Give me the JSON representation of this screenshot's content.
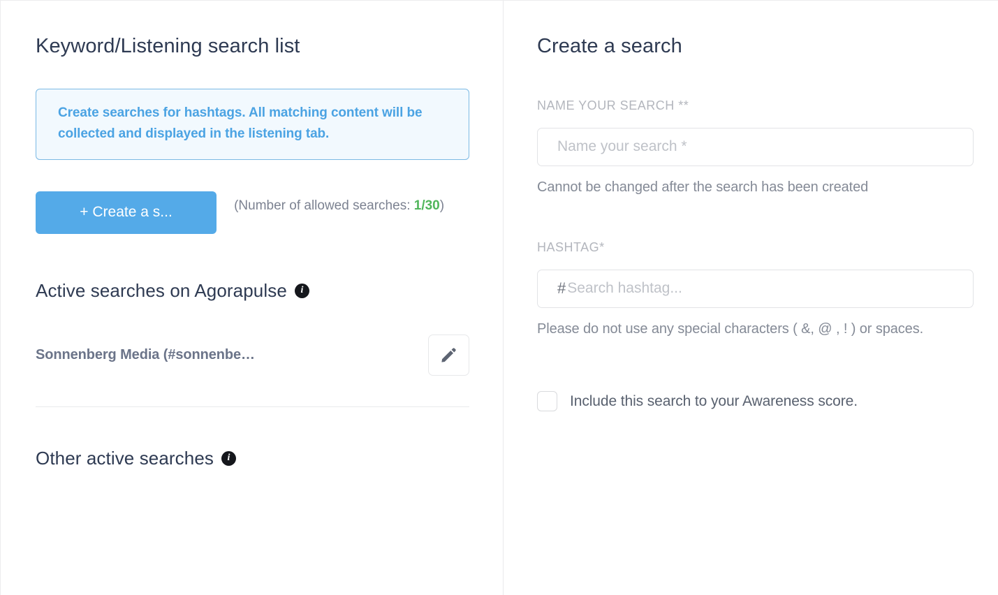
{
  "left": {
    "title": "Keyword/Listening search list",
    "callout": "Create searches for hashtags. All matching content will be collected and displayed in the listening tab.",
    "create_button_label": "+ Create a s...",
    "allowed_prefix": "(Number of allowed searches: ",
    "allowed_count": "1/30",
    "allowed_suffix": ")",
    "active_section_title": "Active searches on Agorapulse",
    "active_info_icon": "info-icon",
    "searches": [
      {
        "label": "Sonnenberg Media (#sonnenbe…",
        "edit_icon": "pencil-icon"
      }
    ],
    "other_section_title": "Other active searches",
    "other_info_icon": "info-icon"
  },
  "right": {
    "title": "Create a search",
    "name_label": "NAME YOUR SEARCH **",
    "name_placeholder": "Name your search *",
    "name_value": "",
    "name_helper": "Cannot be changed after the search has been created",
    "hashtag_label": "HASHTAG*",
    "hashtag_prefix": "#",
    "hashtag_placeholder": "Search hashtag...",
    "hashtag_value": "",
    "hashtag_helper": "Please do not use any special characters ( &, @ , ! ) or spaces.",
    "awareness_checkbox_label": "Include this search to your Awareness score.",
    "awareness_checked": false
  },
  "colors": {
    "accent_blue": "#54aae8",
    "callout_border": "#7bb9e4",
    "callout_bg": "#f2f9fe",
    "callout_text": "#4ba3e3",
    "count_green": "#51b65b",
    "heading_navy": "#2e3a52"
  }
}
